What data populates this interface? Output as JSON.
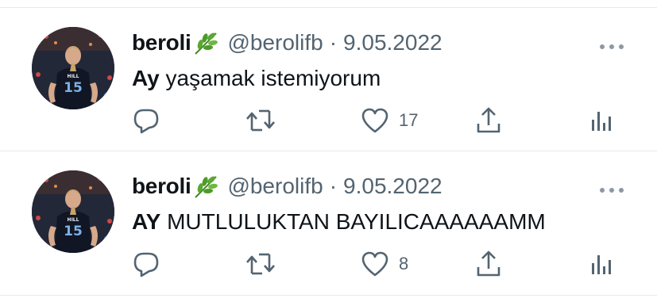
{
  "tweets": [
    {
      "name": "beroli",
      "name_emoji": "herb-emoji",
      "handle": "@berolifb",
      "separator": "·",
      "date": "9.05.2022",
      "text_bold": "Ay",
      "text_rest": " yaşamak istemiyorum",
      "like_count": "17",
      "avatar_jersey_name": "HILL",
      "avatar_jersey_number": "15"
    },
    {
      "name": "beroli",
      "name_emoji": "herb-emoji",
      "handle": "@berolifb",
      "separator": "·",
      "date": "9.05.2022",
      "text_bold": "AY",
      "text_rest": " MUTLULUKTAN BAYILICAAAAAAMM",
      "like_count": "8",
      "avatar_jersey_name": "HILL",
      "avatar_jersey_number": "15"
    }
  ],
  "icons": {
    "reply": "reply-icon",
    "retweet": "retweet-icon",
    "like": "heart-icon",
    "share": "share-icon",
    "views": "analytics-icon",
    "more": "more-icon"
  },
  "colors": {
    "text": "#0f1419",
    "secondary": "#536471",
    "divider": "#e6e9ec",
    "leaf_green": "#4f9a2a"
  }
}
